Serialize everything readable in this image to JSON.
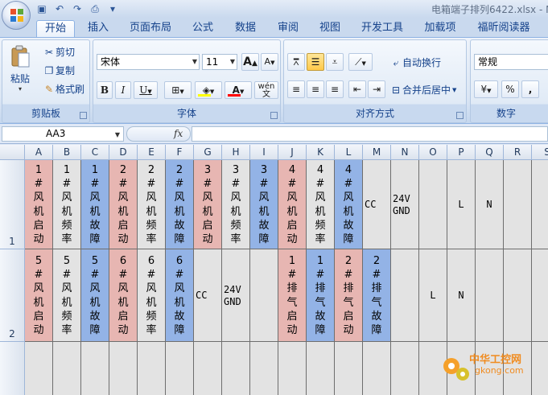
{
  "window": {
    "title": "电箱端子排列6422.xlsx - M"
  },
  "quick_access": {
    "icons": [
      "save-icon",
      "undo-icon",
      "redo-icon",
      "print-preview-icon",
      "customize-icon"
    ]
  },
  "tabs": [
    {
      "label": "开始",
      "active": true
    },
    {
      "label": "插入"
    },
    {
      "label": "页面布局"
    },
    {
      "label": "公式"
    },
    {
      "label": "数据"
    },
    {
      "label": "审阅"
    },
    {
      "label": "视图"
    },
    {
      "label": "开发工具"
    },
    {
      "label": "加载项"
    },
    {
      "label": "福昕阅读器"
    }
  ],
  "ribbon": {
    "clipboard": {
      "group_label": "剪贴板",
      "paste_label": "粘贴",
      "cut_label": "剪切",
      "copy_label": "复制",
      "format_painter_label": "格式刷"
    },
    "font": {
      "group_label": "字体",
      "font_name": "宋体",
      "font_size": "11",
      "bold": "B",
      "italic": "I",
      "underline": "U",
      "grow": "A",
      "shrink": "A",
      "fill_color": "#ffff00",
      "font_color": "#ff0000",
      "phonetic": "wén 文"
    },
    "alignment": {
      "group_label": "对齐方式",
      "wrap_text_label": "自动换行",
      "merge_center_label": "合并后居中"
    },
    "number": {
      "group_label": "数字",
      "format_value": "常规",
      "percent": "%",
      "comma": ","
    }
  },
  "formula_bar": {
    "name_box": "AA3",
    "fx_label": "fx",
    "formula": ""
  },
  "sheet": {
    "columns": [
      "A",
      "B",
      "C",
      "D",
      "E",
      "F",
      "G",
      "H",
      "I",
      "J",
      "K",
      "L",
      "M",
      "N",
      "O",
      "P",
      "Q",
      "R",
      "S"
    ],
    "rows": [
      "1",
      "2"
    ],
    "colors": {
      "pink": "#e7b6b2",
      "blue": "#93b3e6",
      "gray": "#e3e3e3"
    },
    "row1": [
      {
        "text": "1\n#\n风\n机\n启\n动",
        "fill": "pink",
        "vertical": true
      },
      {
        "text": "1\n#\n风\n机\n频\n率",
        "fill": "gray",
        "vertical": true
      },
      {
        "text": "1\n#\n风\n机\n故\n障",
        "fill": "blue",
        "vertical": true
      },
      {
        "text": "2\n#\n风\n机\n启\n动",
        "fill": "pink",
        "vertical": true
      },
      {
        "text": "2\n#\n风\n机\n频\n率",
        "fill": "gray",
        "vertical": true
      },
      {
        "text": "2\n#\n风\n机\n故\n障",
        "fill": "blue",
        "vertical": true
      },
      {
        "text": "3\n#\n风\n机\n启\n动",
        "fill": "pink",
        "vertical": true
      },
      {
        "text": "3\n#\n风\n机\n频\n率",
        "fill": "gray",
        "vertical": true
      },
      {
        "text": "3\n#\n风\n机\n故\n障",
        "fill": "blue",
        "vertical": true
      },
      {
        "text": "4\n#\n风\n机\n启\n动",
        "fill": "pink",
        "vertical": true
      },
      {
        "text": "4\n#\n风\n机\n频\n率",
        "fill": "gray",
        "vertical": true
      },
      {
        "text": "4\n#\n风\n机\n故\n障",
        "fill": "blue",
        "vertical": true
      },
      {
        "text": "CC",
        "fill": "gray",
        "vertical": false
      },
      {
        "text": "24V\nGND",
        "fill": "gray",
        "vertical": false
      },
      {
        "text": "",
        "fill": "gray",
        "vertical": false
      },
      {
        "text": "L",
        "fill": "gray",
        "vertical": false,
        "center": true
      },
      {
        "text": "N",
        "fill": "gray",
        "vertical": false,
        "center": true
      },
      {
        "text": "",
        "fill": "gray",
        "vertical": false
      },
      {
        "text": "",
        "fill": "gray",
        "vertical": false
      }
    ],
    "row2": [
      {
        "text": "5\n#\n风\n机\n启\n动",
        "fill": "pink",
        "vertical": true
      },
      {
        "text": "5\n#\n风\n机\n频\n率",
        "fill": "gray",
        "vertical": true
      },
      {
        "text": "5\n#\n风\n机\n故\n障",
        "fill": "blue",
        "vertical": true
      },
      {
        "text": "6\n#\n风\n机\n启\n动",
        "fill": "pink",
        "vertical": true
      },
      {
        "text": "6\n#\n风\n机\n频\n率",
        "fill": "gray",
        "vertical": true
      },
      {
        "text": "6\n#\n风\n机\n故\n障",
        "fill": "blue",
        "vertical": true
      },
      {
        "text": "CC",
        "fill": "gray",
        "vertical": false
      },
      {
        "text": "24V\nGND",
        "fill": "gray",
        "vertical": false
      },
      {
        "text": "",
        "fill": "gray",
        "vertical": false
      },
      {
        "text": "1\n#\n排\n气\n启\n动",
        "fill": "pink",
        "vertical": true
      },
      {
        "text": "1\n#\n排\n气\n故\n障",
        "fill": "blue",
        "vertical": true
      },
      {
        "text": "2\n#\n排\n气\n启\n动",
        "fill": "pink",
        "vertical": true
      },
      {
        "text": "2\n#\n排\n气\n故\n障",
        "fill": "blue",
        "vertical": true
      },
      {
        "text": "",
        "fill": "gray",
        "vertical": false
      },
      {
        "text": "L",
        "fill": "gray",
        "vertical": false,
        "center": true
      },
      {
        "text": "N",
        "fill": "gray",
        "vertical": false,
        "center": true
      },
      {
        "text": "",
        "fill": "gray",
        "vertical": false
      },
      {
        "text": "",
        "fill": "gray",
        "vertical": false
      },
      {
        "text": "",
        "fill": "gray",
        "vertical": false
      }
    ]
  },
  "watermark": {
    "line1": "中华工控网",
    "line2": "gkong.com"
  }
}
